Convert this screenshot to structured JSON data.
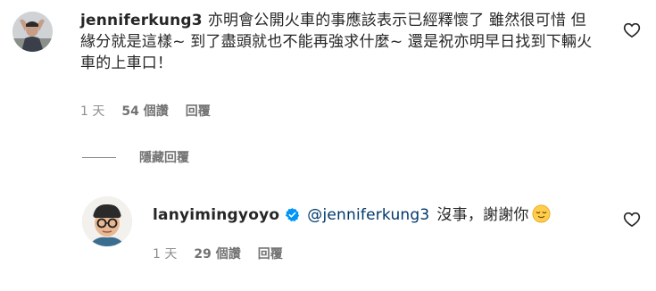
{
  "comments": [
    {
      "username": "jenniferkung3",
      "text": "亦明會公開火車的事應該表示已經釋懷了 雖然很可惜 但緣分就是這樣~ 到了盡頭就也不能再強求什麼~ 還是祝亦明早日找到下輛火車的上車口！",
      "time": "1 天",
      "likes": "54 個讚",
      "reply_label": "回覆"
    },
    {
      "username": "lanyimingyoyo",
      "mention": "@jenniferkung3",
      "text": "沒事，謝謝你",
      "time": "1 天",
      "likes": "29 個讚",
      "reply_label": "回覆"
    }
  ],
  "hide_replies_label": "隱藏回覆",
  "icons": {
    "heart": "heart-outline-icon",
    "verified": "verified-badge-icon",
    "emoji": "relieved-face-emoji"
  },
  "colors": {
    "text": "#262626",
    "meta": "#8e8e8e",
    "mention": "#00376b",
    "verified": "#0095f6"
  }
}
